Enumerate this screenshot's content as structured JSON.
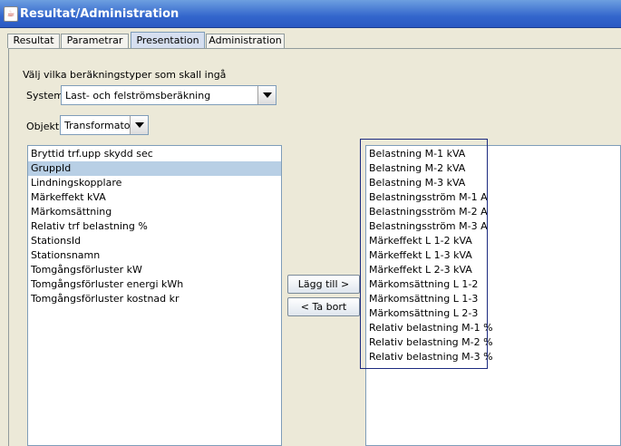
{
  "window": {
    "title": "Resultat/Administration",
    "icon": "java-cup-icon"
  },
  "tabs": [
    {
      "label": "Resultat"
    },
    {
      "label": "Parametrar"
    },
    {
      "label": "Presentation",
      "active": true
    },
    {
      "label": "Administration"
    }
  ],
  "instructions": "Välj vilka beräkningstyper som skall ingå",
  "system": {
    "label": "System",
    "value": "Last- och felströmsberäkning"
  },
  "objekt": {
    "label": "Objekt",
    "value": "Transformator"
  },
  "available": {
    "selected_index": 1,
    "items": [
      "Bryttid trf.upp skydd sec",
      "GruppId",
      "Lindningskopplare",
      "Märkeffekt kVA",
      "Märkomsättning",
      "Relativ trf belastning %",
      "StationsId",
      "Stationsnamn",
      "Tomgångsförluster kW",
      "Tomgångsförluster energi kWh",
      "Tomgångsförluster kostnad kr"
    ]
  },
  "buttons": {
    "add": "Lägg till >",
    "remove": "< Ta bort"
  },
  "chosen": {
    "items": [
      "Belastning M-1 kVA",
      "Belastning M-2 kVA",
      "Belastning M-3 kVA",
      "Belastningsström M-1 A",
      "Belastningsström M-2 A",
      "Belastningsström M-3 A",
      "Märkeffekt L 1-2 kVA",
      "Märkeffekt L 1-3 kVA",
      "Märkeffekt L 2-3 kVA",
      "Märkomsättning L 1-2",
      "Märkomsättning L 1-3",
      "Märkomsättning L 2-3",
      "Relativ belastning M-1 %",
      "Relativ belastning M-2 %",
      "Relativ belastning M-3 %"
    ]
  }
}
